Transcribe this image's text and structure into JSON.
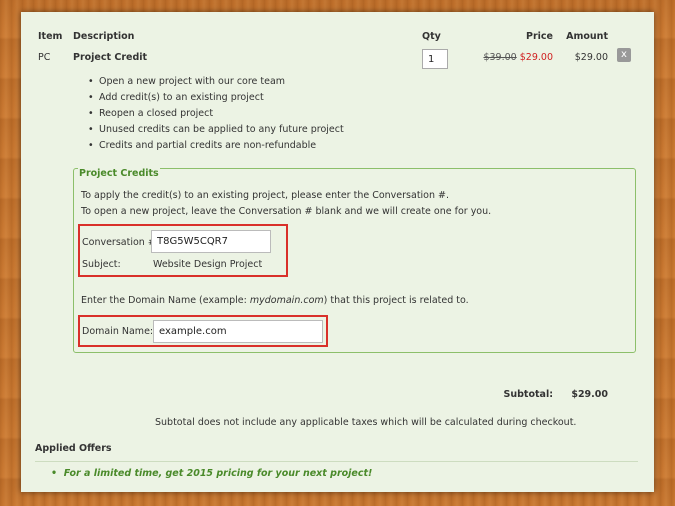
{
  "table": {
    "headers": {
      "item": "Item",
      "description": "Description",
      "qty": "Qty",
      "price": "Price",
      "amount": "Amount"
    },
    "row": {
      "item": "PC",
      "description": "Project Credit",
      "qty": "1",
      "original_price": "$39.00",
      "sale_price": "$29.00",
      "amount": "$29.00",
      "remove_label": "x"
    }
  },
  "features": [
    "Open a new project with our core team",
    "Add credit(s) to an existing project",
    "Reopen a closed project",
    "Unused credits can be applied to any future project",
    "Credits and partial credits are non-refundable"
  ],
  "project_credits": {
    "legend": "Project Credits",
    "instruction_1": "To apply the credit(s) to an existing project, please enter the Conversation #.",
    "instruction_2": "To open a new project, leave the Conversation # blank and we will create one for you.",
    "conversation_label": "Conversation #:",
    "conversation_value": "T8G5W5CQR7",
    "subject_label": "Subject:",
    "subject_value": "Website Design Project",
    "domain_prompt_before": "Enter the Domain Name (example: ",
    "domain_prompt_example": "mydomain.com",
    "domain_prompt_after": ") that this project is related to.",
    "domain_label": "Domain Name:*",
    "domain_value": "example.com"
  },
  "totals": {
    "subtotal_label": "Subtotal:",
    "subtotal_value": "$29.00",
    "tax_note": "Subtotal does not include any applicable taxes which will be calculated during checkout."
  },
  "offers": {
    "heading": "Applied Offers",
    "items": [
      "For a limited time, get 2015 pricing for your next project!"
    ]
  },
  "colors": {
    "panel_bg": "#ecf3e4",
    "accent_green": "#4a8a2a",
    "sale_red": "#d02020",
    "highlight_red": "#d9302a"
  }
}
